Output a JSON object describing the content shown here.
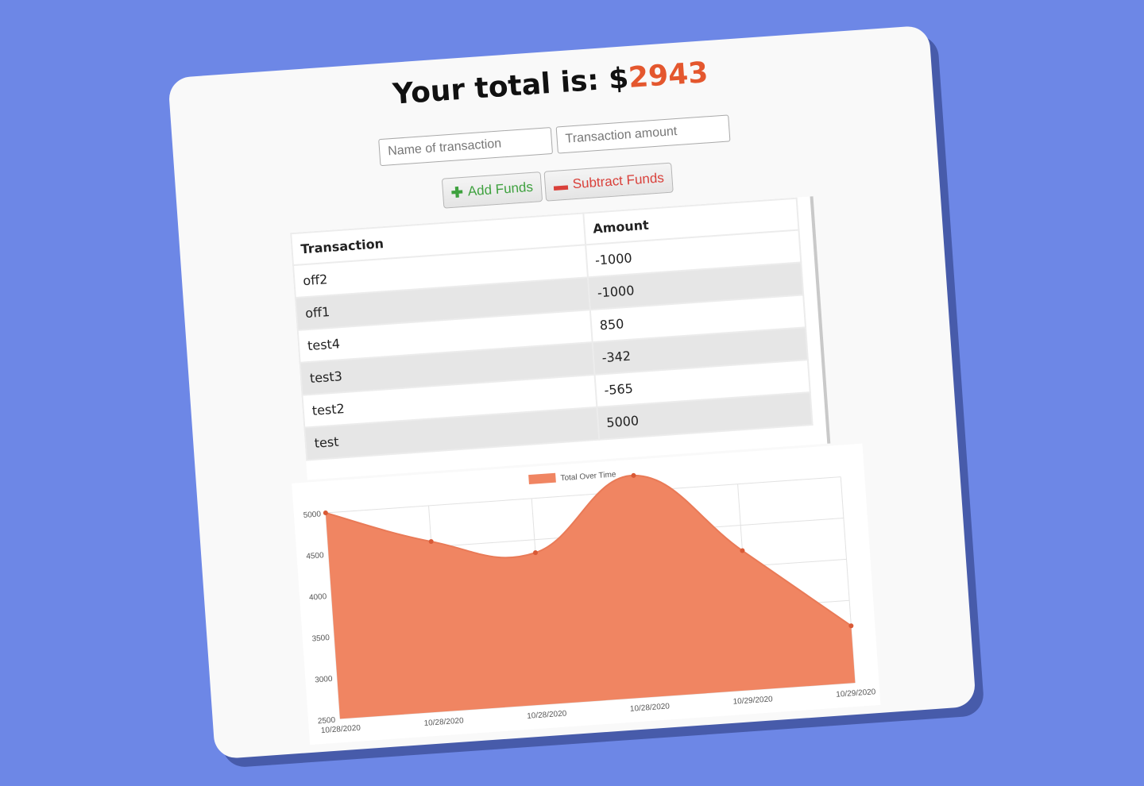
{
  "header": {
    "title_prefix": "Your total is: $",
    "total": "2943"
  },
  "form": {
    "name_placeholder": "Name of transaction",
    "amount_placeholder": "Transaction amount",
    "add_label": "Add Funds",
    "subtract_label": "Subtract Funds"
  },
  "table": {
    "headers": [
      "Transaction",
      "Amount"
    ],
    "rows": [
      {
        "name": "off2",
        "amount": "-1000"
      },
      {
        "name": "off1",
        "amount": "-1000"
      },
      {
        "name": "test4",
        "amount": "850"
      },
      {
        "name": "test3",
        "amount": "-342"
      },
      {
        "name": "test2",
        "amount": "-565"
      },
      {
        "name": "test",
        "amount": "5000"
      }
    ]
  },
  "colors": {
    "accent": "#e4572e",
    "chart_fill": "#f08562",
    "add": "#3ea13e",
    "subtract": "#d9403a"
  },
  "chart_data": {
    "type": "area",
    "categories": [
      "10/28/2020",
      "10/28/2020",
      "10/28/2020",
      "10/28/2020",
      "10/29/2020",
      "10/29/2020"
    ],
    "series": [
      {
        "name": "Total Over Time",
        "values": [
          5000,
          4565,
          4342,
          5192,
          4192,
          3192
        ]
      }
    ],
    "ylim": [
      2500,
      5000
    ],
    "yticks": [
      "2500",
      "3000",
      "3500",
      "4000",
      "4500",
      "5000"
    ],
    "grid": true,
    "legend": "top"
  }
}
